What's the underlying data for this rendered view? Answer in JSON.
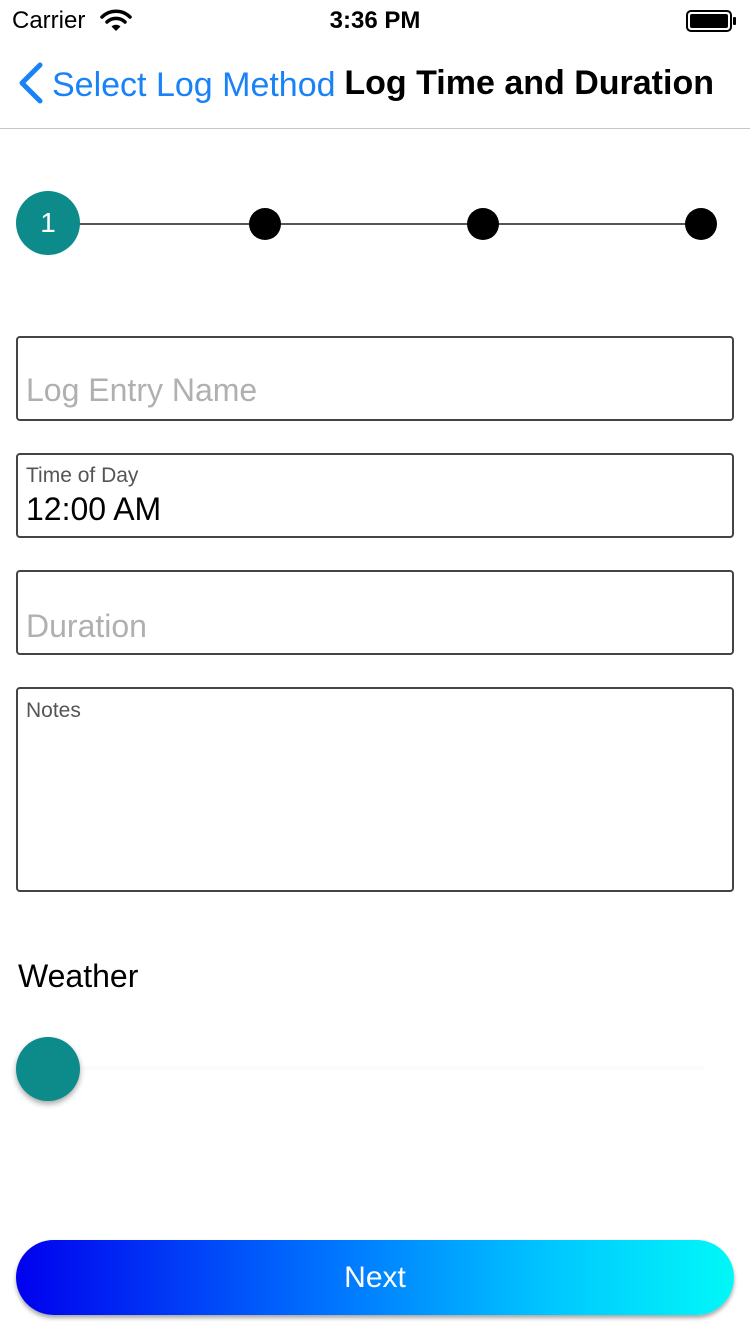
{
  "status_bar": {
    "carrier": "Carrier",
    "time": "3:36 PM"
  },
  "nav": {
    "back_label": "Select Log Method",
    "title": "Log Time and Duration",
    "accent_color": "#1a82f7"
  },
  "stepper": {
    "current_step": "1",
    "total_steps": 4,
    "active_color": "#0c8b8a"
  },
  "form": {
    "name_placeholder": "Log Entry Name",
    "time_label": "Time of Day",
    "time_value": "12:00 AM",
    "duration_placeholder": "Duration",
    "notes_label": "Notes"
  },
  "weather": {
    "label": "Weather",
    "slider_value": 0
  },
  "next_button": {
    "label": "Next"
  }
}
